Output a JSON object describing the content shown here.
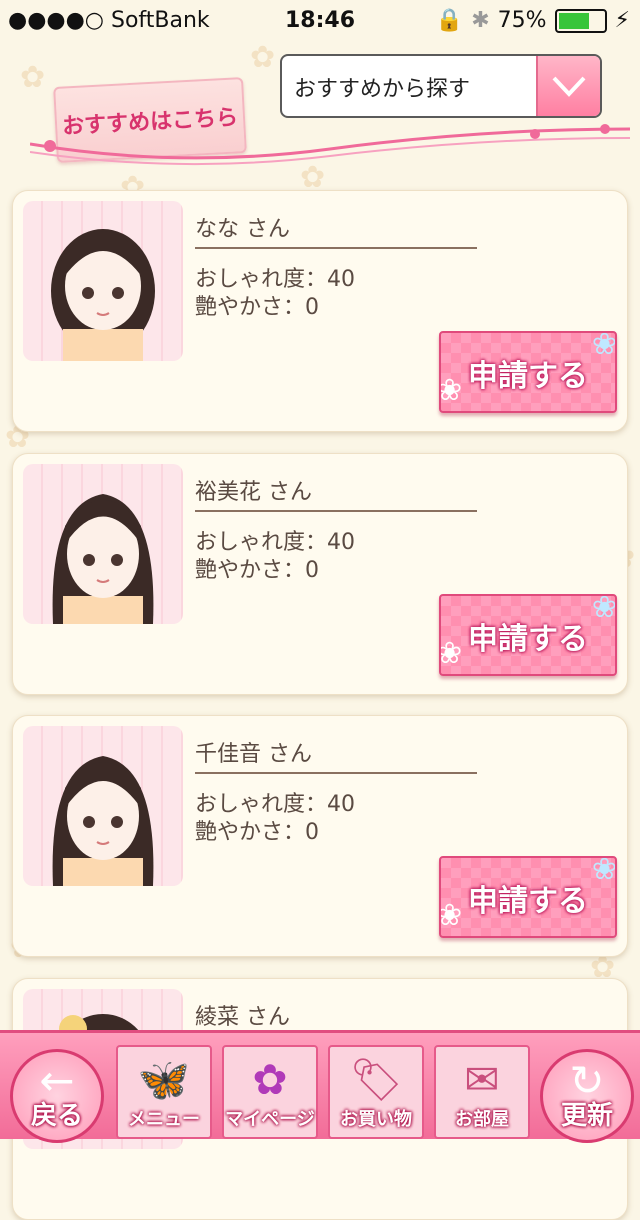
{
  "status_bar": {
    "carrier": "●●●●○ SoftBank",
    "time": "18:46",
    "battery": "75%"
  },
  "header": {
    "label": "おすすめはこちら",
    "dropdown_value": "おすすめから探す"
  },
  "cards": [
    {
      "name": "なな さん",
      "stat1": "おしゃれ度：40",
      "stat2": "艶やかさ：0",
      "button": "申請する"
    },
    {
      "name": "裕美花 さん",
      "stat1": "おしゃれ度：40",
      "stat2": "艶やかさ：0",
      "button": "申請する"
    },
    {
      "name": "千佳音 さん",
      "stat1": "おしゃれ度：40",
      "stat2": "艶やかさ：0",
      "button": "申請する"
    },
    {
      "name": "綾菜 さん"
    }
  ],
  "nav": {
    "back": "戻る",
    "menu": "メニュー",
    "mypage": "マイページ",
    "shopping": "お買い物",
    "room": "お部屋",
    "refresh": "更新"
  },
  "colors": {
    "accent": "#ff7fa2",
    "background": "#fbf6e6"
  }
}
